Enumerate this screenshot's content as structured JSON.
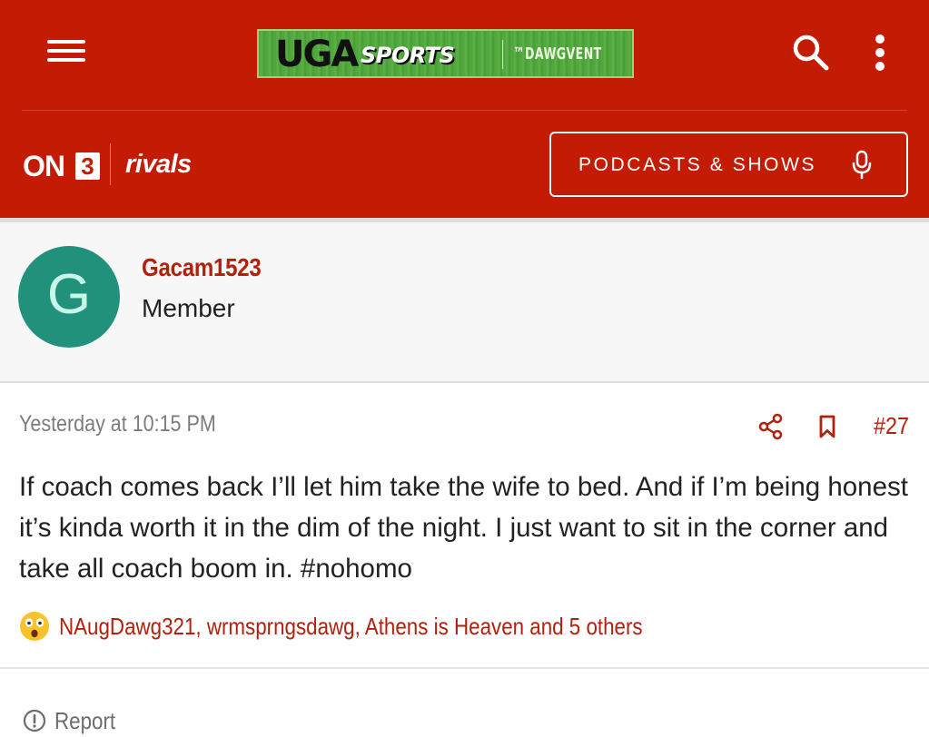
{
  "header": {
    "logo": {
      "text_main": "UGA",
      "text_sports": "SPORTS",
      "text_dawgvent": "™DAWGVENT"
    },
    "brands": {
      "on3_text": "ON",
      "on3_number": "3",
      "rivals": "rivals"
    },
    "podcasts_button": "PODCASTS & SHOWS",
    "icons": [
      "menu-icon",
      "search-icon",
      "more-vertical-icon",
      "microphone-icon"
    ],
    "colors": {
      "background": "#c41b05",
      "text": "#ffffff"
    }
  },
  "member": {
    "avatar_letter": "G",
    "username": "Gacam1523",
    "role": "Member",
    "colors": {
      "avatar": "#21917c",
      "username": "#b3210c"
    }
  },
  "post": {
    "timestamp": "Yesterday at 10:15 PM",
    "number": "#27",
    "body": "If coach comes back I’ll let him take the wife to bed. And if I’m being honest it’s kinda worth it in the dim of the night. I just want to sit in the corner and take all coach boom in. #nohomo",
    "reactions": {
      "emoji": "astonished-face-emoji",
      "names": "NAugDawg321, wrmsprngsdawg, Athens is Heaven and 5 others"
    },
    "actions": [
      "share-icon",
      "bookmark-icon"
    ]
  },
  "footer": {
    "report_label": "Report",
    "report_icon": "alert-circle-icon"
  }
}
